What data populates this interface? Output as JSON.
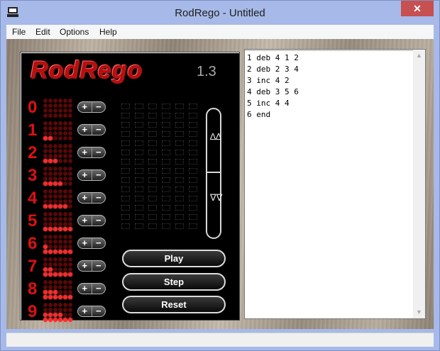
{
  "window": {
    "title": "RodRego - Untitled",
    "close_glyph": "✕"
  },
  "menu": [
    "File",
    "Edit",
    "Options",
    "Help"
  ],
  "machine": {
    "logo": "RodRego",
    "version": "1.3",
    "registers": [
      {
        "label": "0",
        "count": 0
      },
      {
        "label": "1",
        "count": 2
      },
      {
        "label": "2",
        "count": 3
      },
      {
        "label": "3",
        "count": 4
      },
      {
        "label": "4",
        "count": 5
      },
      {
        "label": "5",
        "count": 6
      },
      {
        "label": "6",
        "count": 7
      },
      {
        "label": "7",
        "count": 8
      },
      {
        "label": "8",
        "count": 9
      },
      {
        "label": "9",
        "count": 10
      }
    ],
    "plus": "+",
    "minus": "−",
    "scroll_up_glyph": "∆∆",
    "scroll_down_glyph": "∇∇",
    "buttons": {
      "play": "Play",
      "step": "Step",
      "reset": "Reset"
    }
  },
  "editor": {
    "code": "1 deb 4 1 2\n2 deb 2 3 4\n3 inc 4 2\n4 deb 3 5 6\n5 inc 4 4\n6 end",
    "scroll_up": "▲",
    "scroll_down": "▼"
  },
  "icons": {
    "app": "computer-icon",
    "close": "close-icon",
    "scroll_up": "up-arrow-icon",
    "scroll_down": "down-arrow-icon"
  },
  "colors": {
    "titlebar": "#a6b9e8",
    "close": "#c75050",
    "bead_on": "#ff2a2a",
    "bead_off": "#5a0808",
    "register_number": "#e01010",
    "logo": "#b50f0f"
  }
}
